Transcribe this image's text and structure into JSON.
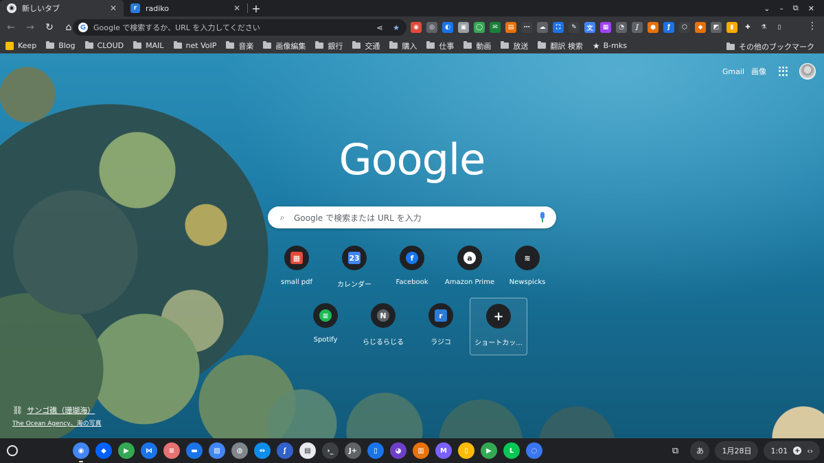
{
  "tabs": [
    {
      "title": "新しいタブ",
      "active": true,
      "favicon": "chrome-icon"
    },
    {
      "title": "radiko",
      "active": false,
      "favicon": "radiko-icon"
    }
  ],
  "newtab_label": "+",
  "window_controls": {
    "chevron": "⌄",
    "minimize": "–",
    "restore": "⧉",
    "close": "✕"
  },
  "toolbar": {
    "back": "←",
    "forward": "→",
    "reload": "↻",
    "home": "⌂",
    "omnibox_placeholder": "Google で検索するか、URL を入力してください",
    "share_icon": "⟨",
    "star_icon": "★",
    "extensions": [
      {
        "name": "ext-1",
        "color": "#e34a3b",
        "glyph": "◉"
      },
      {
        "name": "ext-2",
        "color": "#5f6368",
        "glyph": "◎"
      },
      {
        "name": "ext-3",
        "color": "#1a73e8",
        "glyph": "◐"
      },
      {
        "name": "ext-4",
        "color": "#9aa0a6",
        "glyph": "▣"
      },
      {
        "name": "ext-5",
        "color": "#34a853",
        "glyph": "◯"
      },
      {
        "name": "ext-6",
        "color": "#188038",
        "glyph": "✉"
      },
      {
        "name": "ext-7",
        "color": "#e8710a",
        "glyph": "▤"
      },
      {
        "name": "ext-8",
        "color": "#3c4043",
        "glyph": "⋯"
      },
      {
        "name": "ext-9",
        "color": "#5f6368",
        "glyph": "☁"
      },
      {
        "name": "ext-10",
        "color": "#1a73e8",
        "glyph": "⛶"
      },
      {
        "name": "ext-11",
        "color": "#3c4043",
        "glyph": "✎"
      },
      {
        "name": "ext-12",
        "color": "#4285f4",
        "glyph": "文"
      },
      {
        "name": "ext-13",
        "color": "#a142f4",
        "glyph": "▦"
      },
      {
        "name": "ext-14",
        "color": "#5f6368",
        "glyph": "◔"
      },
      {
        "name": "ext-15",
        "color": "#5f6368",
        "glyph": "∫"
      },
      {
        "name": "ext-16",
        "color": "#e8710a",
        "glyph": "●"
      },
      {
        "name": "ext-17",
        "color": "#1a73e8",
        "glyph": "ƒ"
      },
      {
        "name": "ext-18",
        "color": "#3c4043",
        "glyph": "⬡"
      },
      {
        "name": "ext-19",
        "color": "#e8710a",
        "glyph": "◆"
      },
      {
        "name": "ext-20",
        "color": "#5f6368",
        "glyph": "◩"
      },
      {
        "name": "ext-21",
        "color": "#f9ab00",
        "glyph": "▮"
      }
    ],
    "puzzle_icon": "✚",
    "flask_icon": "⚗",
    "sidepanel_icon": "▯",
    "menu_icon": "⋮"
  },
  "bookmarks": [
    {
      "label": "Keep",
      "type": "keep"
    },
    {
      "label": "Blog",
      "type": "folder"
    },
    {
      "label": "CLOUD",
      "type": "folder"
    },
    {
      "label": "MAIL",
      "type": "folder"
    },
    {
      "label": "net VoIP",
      "type": "folder"
    },
    {
      "label": "音楽",
      "type": "folder"
    },
    {
      "label": "画像編集",
      "type": "folder"
    },
    {
      "label": "銀行",
      "type": "folder"
    },
    {
      "label": "交通",
      "type": "folder"
    },
    {
      "label": "購入",
      "type": "folder"
    },
    {
      "label": "仕事",
      "type": "folder"
    },
    {
      "label": "動画",
      "type": "folder"
    },
    {
      "label": "放送",
      "type": "folder"
    },
    {
      "label": "翻訳 検索",
      "type": "folder"
    },
    {
      "label": "B-mks",
      "type": "star"
    }
  ],
  "other_bookmarks": "その他のブックマーク",
  "ntp": {
    "gmail": "Gmail",
    "images": "画像",
    "logo": "Google",
    "search_placeholder": "Google で検索または URL を入力",
    "shortcuts": [
      {
        "label": "small pdf",
        "icon": "smallpdf-icon",
        "bg": "#e34a3b",
        "glyph": "▦"
      },
      {
        "label": "カレンダー",
        "icon": "calendar-icon",
        "bg": "#4285f4",
        "glyph": "23"
      },
      {
        "label": "Facebook",
        "icon": "facebook-icon",
        "bg": "#1877f2",
        "glyph": "f"
      },
      {
        "label": "Amazon Prime",
        "icon": "amazon-icon",
        "bg": "#ffffff",
        "glyph": "a"
      },
      {
        "label": "Newspicks",
        "icon": "newspicks-icon",
        "bg": "#202124",
        "glyph": "≋"
      },
      {
        "label": "Spotify",
        "icon": "spotify-icon",
        "bg": "#1db954",
        "glyph": "≡"
      },
      {
        "label": "らじるらじる",
        "icon": "letter-n-icon",
        "bg": "#5f6368",
        "glyph": "N"
      },
      {
        "label": "ラジコ",
        "icon": "radiko-icon",
        "bg": "#2b7bd8",
        "glyph": "r"
      },
      {
        "label": "ショートカッ...",
        "icon": "plus-icon",
        "bg": "",
        "glyph": "+"
      }
    ],
    "credit_title": "サンゴ礁（珊瑚海）",
    "credit_sub": "The Ocean Agency、海の写真"
  },
  "shelf": {
    "apps": [
      {
        "name": "chrome-app",
        "color": "#4285f4",
        "glyph": "◉",
        "running": true
      },
      {
        "name": "dropbox-app",
        "color": "#0061ff",
        "glyph": "◆",
        "running": false
      },
      {
        "name": "play-store-app",
        "color": "#34a853",
        "glyph": "▶",
        "running": false
      },
      {
        "name": "butterfly-app",
        "color": "#1a73e8",
        "glyph": "⋈",
        "running": false
      },
      {
        "name": "toggl-app",
        "color": "#e57373",
        "glyph": "≡",
        "running": false
      },
      {
        "name": "files-app",
        "color": "#1a73e8",
        "glyph": "▬",
        "running": false
      },
      {
        "name": "gallery-app",
        "color": "#4285f4",
        "glyph": "▨",
        "running": false
      },
      {
        "name": "globe-app",
        "color": "#80868b",
        "glyph": "◍",
        "running": false
      },
      {
        "name": "teamviewer-app",
        "color": "#0e8ee9",
        "glyph": "⇔",
        "running": false
      },
      {
        "name": "simplenote-app",
        "color": "#3361cc",
        "glyph": "ʃ",
        "running": false
      },
      {
        "name": "docs-app",
        "color": "#e8eaed",
        "glyph": "▤",
        "running": false
      },
      {
        "name": "terminal-app",
        "color": "#3c4043",
        "glyph": "›_",
        "running": false
      },
      {
        "name": "jota-app",
        "color": "#5f6368",
        "glyph": "J+",
        "running": false
      },
      {
        "name": "book-app",
        "color": "#1a73e8",
        "glyph": "▯",
        "running": false
      },
      {
        "name": "github-app",
        "color": "#6e40c9",
        "glyph": "◕",
        "running": false
      },
      {
        "name": "tool-app",
        "color": "#e8710a",
        "glyph": "▥",
        "running": false
      },
      {
        "name": "mail-app",
        "color": "#7b61ff",
        "glyph": "M",
        "running": false
      },
      {
        "name": "keep-app",
        "color": "#fbbc04",
        "glyph": "▯",
        "running": false
      },
      {
        "name": "play-app",
        "color": "#34a853",
        "glyph": "▶",
        "running": false
      },
      {
        "name": "line-app",
        "color": "#06c755",
        "glyph": "L",
        "running": false
      },
      {
        "name": "signal-app",
        "color": "#3a76f0",
        "glyph": "◌",
        "running": false
      }
    ],
    "ime": "あ",
    "date": "1月28日",
    "time": "1:01"
  }
}
